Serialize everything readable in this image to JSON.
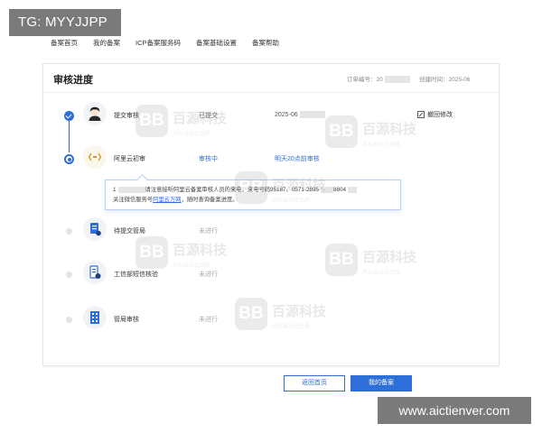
{
  "overlay_top": "TG: MYYJJPP",
  "overlay_bottom": "www.aictienver.com",
  "nav": {
    "items": [
      "备案首页",
      "我的备案",
      "ICP备案服务码",
      "备案基础设置",
      "备案帮助"
    ]
  },
  "panel": {
    "title": "审核进度",
    "order_label": "订单编号：20",
    "created_label": "创建时间：2025-06"
  },
  "steps": [
    {
      "name": "提交审核",
      "status": "已提交",
      "extra": "2025-06",
      "state": "done",
      "icon": "avatar-icon"
    },
    {
      "name": "阿里云初审",
      "status": "审核中",
      "extra": "明天20点前审核",
      "state": "active",
      "icon": "audit-icon"
    },
    {
      "name": "待提交管局",
      "status": "未进行",
      "state": "pending",
      "icon": "document-icon"
    },
    {
      "name": "工信部短信核验",
      "status": "未进行",
      "state": "pending",
      "icon": "sms-verify-icon"
    },
    {
      "name": "管局审核",
      "status": "未进行",
      "state": "pending",
      "icon": "building-icon"
    }
  ],
  "revoke_label": "撤回修改",
  "tip": {
    "prefix": "1",
    "line1": "请注意接听阿里云备案审核人员的来电，来电号码95187、0571-2895",
    "line1_end": "8804",
    "line2_a": "关注微信服务号",
    "line2_link": "阿里云万网",
    "line2_b": "，随时查询备案进度。"
  },
  "watermark": {
    "logo_text": "BB",
    "name": "百源科技",
    "slogan": "月标准价比品质"
  },
  "buttons": {
    "home": "返回首页",
    "mine": "我的备案"
  },
  "colors": {
    "accent": "#2d6ed8",
    "overlay": "#7a7a7a"
  }
}
